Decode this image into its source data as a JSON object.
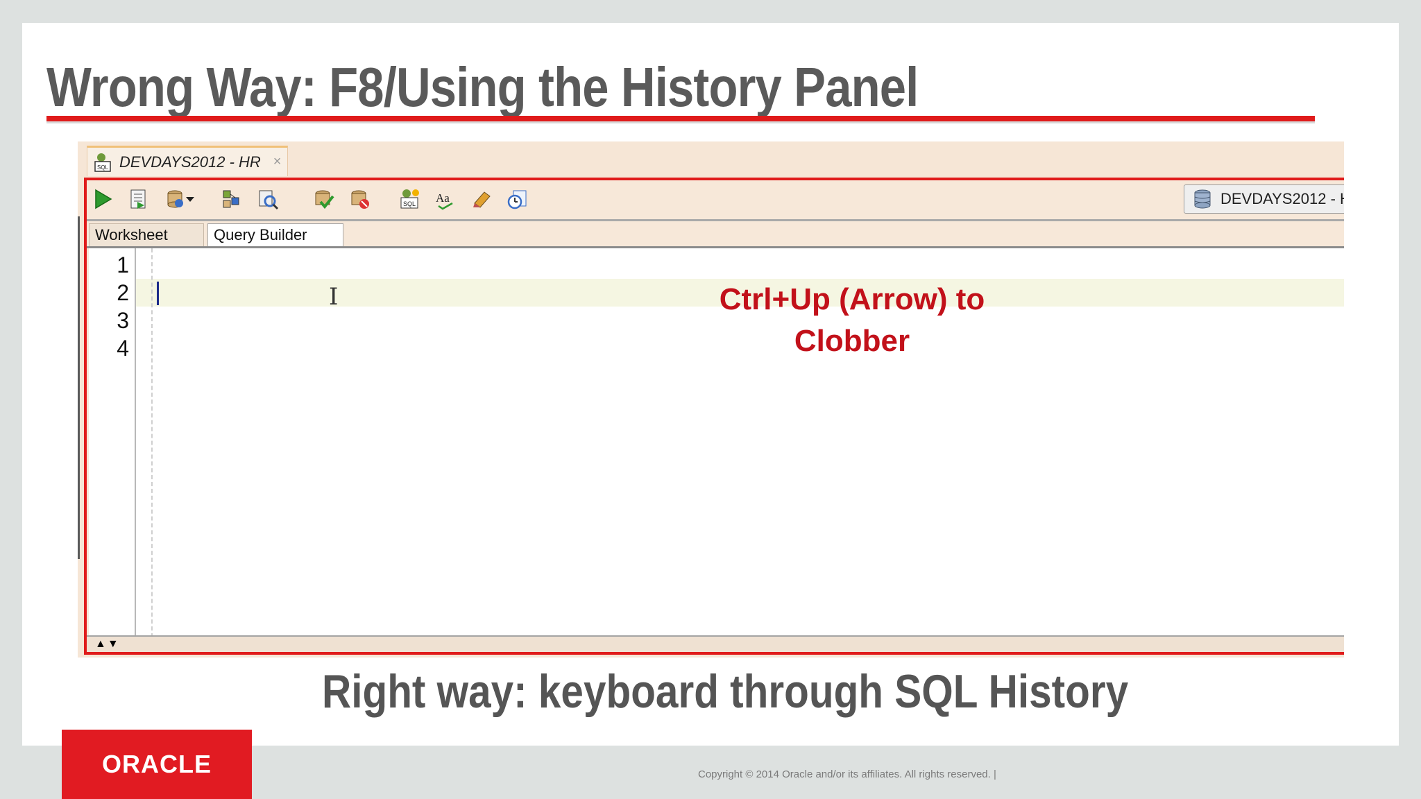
{
  "slide": {
    "title": "Wrong Way: F8/Using the History Panel",
    "subtitle": "Right way: keyboard through SQL History",
    "logo_text": "ORACLE",
    "copyright": "Copyright © 2014 Oracle and/or its affiliates. All rights reserved.  |"
  },
  "app": {
    "document_tab": "DEVDAYS2012 - HR",
    "close_glyph": "×",
    "connection_selector": "DEVDAYS2012 - H",
    "subtabs": [
      "Worksheet",
      "Query Builder"
    ],
    "line_numbers": [
      "1",
      "2",
      "3",
      "4"
    ],
    "annotation_lines": [
      "Ctrl+Up (Arrow) to",
      "Clobber"
    ],
    "scroll_arrows": "▲▼",
    "ibeam_glyph": "I",
    "toolbar_icons": [
      "run-statement-icon",
      "run-script-icon",
      "autotrace-icon",
      "dropdown-arrow-icon",
      "explain-plan-icon",
      "sql-tuning-icon",
      "commit-icon",
      "rollback-icon",
      "unshared-sql-icon",
      "format-sql-icon",
      "clear-icon",
      "sql-history-icon"
    ]
  },
  "colors": {
    "accent_red": "#e01b1b",
    "annotation_red": "#c2111a",
    "title_gray": "#5a5a5a",
    "oracle_red": "#e11b22"
  }
}
